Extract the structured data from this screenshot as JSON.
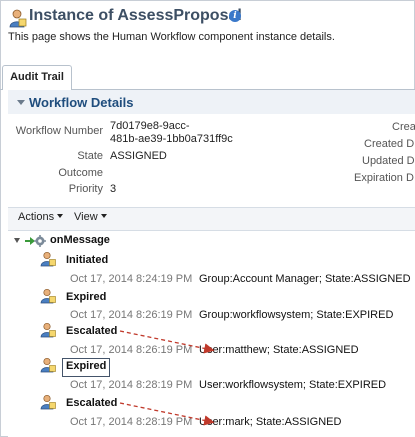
{
  "header": {
    "title": "Instance of AssessProposal",
    "subtitle": "This page shows the Human Workflow component instance details.",
    "icon": "workflow-person-icon",
    "info_icon_text": "i"
  },
  "tabs": [
    {
      "label": "Audit Trail",
      "selected": true
    }
  ],
  "details": {
    "section_title": "Workflow Details",
    "fields": [
      {
        "label": "Workflow Number",
        "value_line1": "7d0179e8-9acc-",
        "value_line2": "481b-ae39-1bb0a731ff9c"
      },
      {
        "label": "State",
        "value": "ASSIGNED"
      },
      {
        "label": "Outcome",
        "value": ""
      },
      {
        "label": "Priority",
        "value": "3"
      }
    ],
    "right_labels": [
      "Crea",
      "Created D",
      "Updated D",
      "Expiration D"
    ]
  },
  "toolbar": {
    "actions_label": "Actions",
    "view_label": "View"
  },
  "tree": {
    "root_label": "onMessage",
    "events": [
      {
        "label": "Initiated",
        "time": "Oct 17, 2014 8:24:19 PM",
        "detail": "Group:Account Manager; State:ASSIGNED"
      },
      {
        "label": "Expired",
        "time": "Oct 17, 2014 8:26:19 PM",
        "detail": "Group:workflowsystem; State:EXPIRED"
      },
      {
        "label": "Escalated",
        "time": "Oct 17, 2014 8:26:19 PM",
        "detail": "User:matthew; State:ASSIGNED"
      },
      {
        "label": "Expired",
        "time": "Oct 17, 2014 8:28:19 PM",
        "detail": "User:workflowsystem; State:EXPIRED",
        "selected": true
      },
      {
        "label": "Escalated",
        "time": "Oct 17, 2014 8:28:19 PM",
        "detail": "User:mark; State:ASSIGNED"
      }
    ]
  },
  "colors": {
    "title": "#3d4f64",
    "section_title": "#1f4d7d",
    "annotation_arrow": "#c0392b",
    "timestamp": "#777777"
  }
}
